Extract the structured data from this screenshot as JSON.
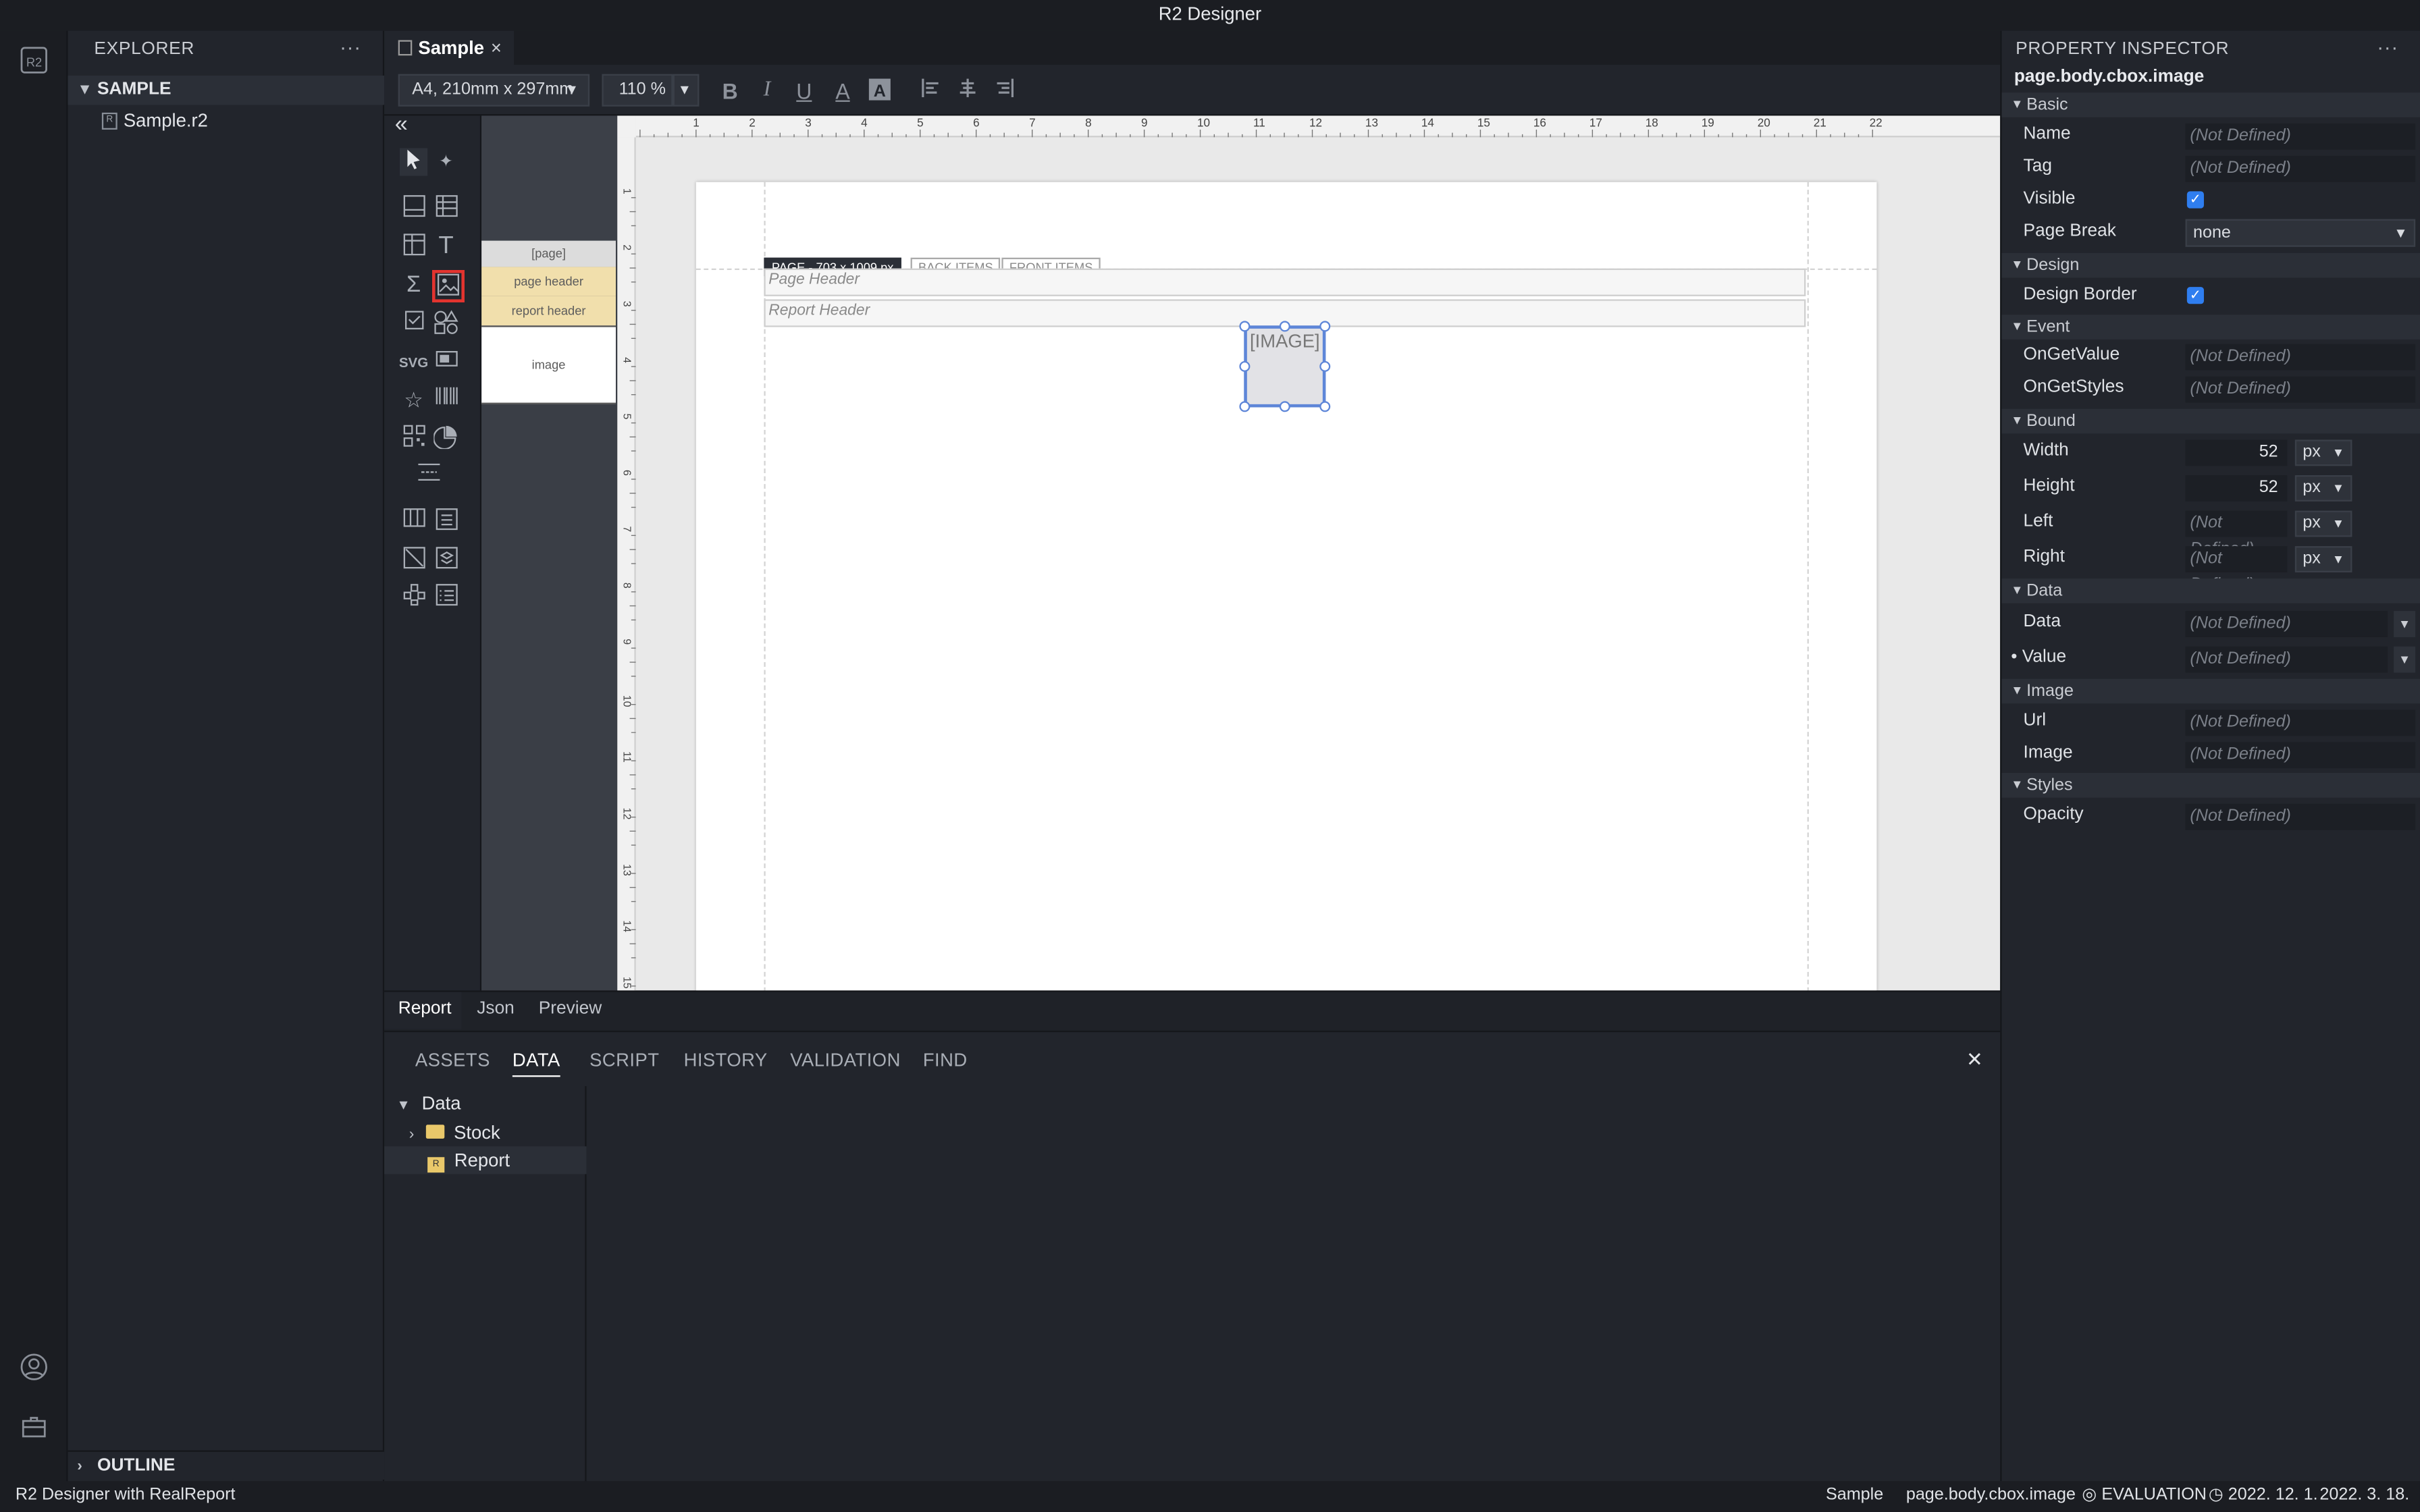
{
  "window": {
    "title": "R2 Designer"
  },
  "explorer": {
    "title": "EXPLORER",
    "more": "···",
    "section": "SAMPLE",
    "file": "Sample.r2",
    "outline": "OUTLINE"
  },
  "editor": {
    "tab": "Sample",
    "tab_close": "×",
    "page_size": "A4, 210mm x 297mm",
    "zoom": "110 %"
  },
  "palette": {
    "collapse": "«",
    "svg_label": "SVG"
  },
  "bands": {
    "page": "[page]",
    "page_header": "page header",
    "report_header": "report header",
    "image": "image"
  },
  "canvas": {
    "page_tag": "PAGE - 703 x 1009 px",
    "back_items": "BACK ITEMS",
    "front_items": "FRONT ITEMS",
    "page_header_band": "Page Header",
    "report_header_band": "Report Header",
    "image_placeholder": "[IMAGE]",
    "ruler_h": [
      "1",
      "2",
      "3",
      "4",
      "5",
      "6",
      "7",
      "8",
      "9",
      "10",
      "11",
      "12",
      "13",
      "14",
      "15",
      "16",
      "17",
      "18",
      "19",
      "20",
      "21",
      "22"
    ],
    "ruler_v": [
      "1",
      "2",
      "3",
      "4",
      "5",
      "6",
      "7",
      "8",
      "9",
      "10",
      "11",
      "12",
      "13",
      "14",
      "15"
    ]
  },
  "view_tabs": [
    "Report",
    "Json",
    "Preview"
  ],
  "bottom_panel": {
    "tabs": [
      "ASSETS",
      "DATA",
      "SCRIPT",
      "HISTORY",
      "VALIDATION",
      "FIND"
    ],
    "active_tab": "DATA",
    "close": "✕",
    "tree": {
      "root": "Data",
      "folder": "Stock",
      "item": "Report"
    }
  },
  "inspector": {
    "title": "PROPERTY INSPECTOR",
    "more": "···",
    "path": "page.body.cbox.image",
    "sections": {
      "basic": "Basic",
      "design": "Design",
      "event": "Event",
      "bound": "Bound",
      "data": "Data",
      "image": "Image",
      "styles": "Styles"
    },
    "labels": {
      "name": "Name",
      "tag": "Tag",
      "visible": "Visible",
      "page_break": "Page Break",
      "design_border": "Design Border",
      "on_get_value": "OnGetValue",
      "on_get_styles": "OnGetStyles",
      "width": "Width",
      "height": "Height",
      "left": "Left",
      "right": "Right",
      "data": "Data",
      "value": "Value",
      "url": "Url",
      "image": "Image",
      "opacity": "Opacity"
    },
    "not_defined": "(Not Defined)",
    "page_break_value": "none",
    "width_value": "52",
    "height_value": "52",
    "unit": "px",
    "visible_checked": true,
    "design_border_checked": true
  },
  "status": {
    "left": "R2 Designer with RealReport",
    "file": "Sample",
    "path": "page.body.cbox.image",
    "license": "EVALUATION",
    "date1": "2022. 12. 1.",
    "date2": "2022. 3. 18."
  }
}
